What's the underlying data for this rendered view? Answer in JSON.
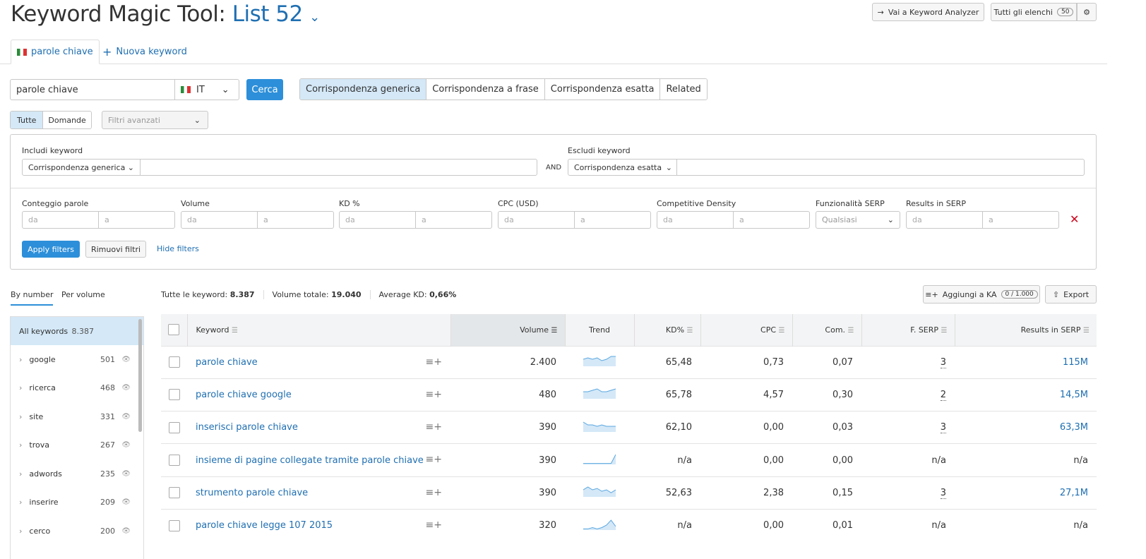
{
  "header": {
    "title": "Keyword Magic Tool:",
    "list_name": "List 52",
    "analyzer_btn": "Vai a Keyword Analyzer",
    "all_lists_btn": "Tutti gli elenchi",
    "all_lists_count": "50"
  },
  "tabs": [
    {
      "label": "parole chiave"
    },
    {
      "label": "Nuova keyword"
    }
  ],
  "search": {
    "value": "parole chiave",
    "country": "IT",
    "search_btn": "Cerca"
  },
  "match_modes": [
    "Corrispondenza generica",
    "Corrispondenza a frase",
    "Corrispondenza esatta",
    "Related"
  ],
  "question_filter": [
    "Tutte",
    "Domande"
  ],
  "advanced_filters": "Filtri avanzati",
  "filters": {
    "include_label": "Includi keyword",
    "include_mode": "Corrispondenza generica",
    "and": "AND",
    "exclude_label": "Escludi keyword",
    "exclude_mode": "Corrispondenza esatta",
    "ranges": [
      "Conteggio parole",
      "Volume",
      "KD %",
      "CPC (USD)",
      "Competitive Density"
    ],
    "from": "da",
    "to": "a",
    "serp_features_label": "Funzionalità SERP",
    "serp_features_value": "Qualsiasi",
    "results_label": "Results in SERP",
    "apply": "Apply filters",
    "remove": "Rimuovi filtri",
    "hide": "Hide filters"
  },
  "sidebar": {
    "tabs": [
      "By number",
      "Per volume"
    ],
    "all_label": "All keywords",
    "all_count": "8.387",
    "items": [
      {
        "label": "google",
        "count": "501"
      },
      {
        "label": "ricerca",
        "count": "468"
      },
      {
        "label": "site",
        "count": "331"
      },
      {
        "label": "trova",
        "count": "267"
      },
      {
        "label": "adwords",
        "count": "235"
      },
      {
        "label": "inserire",
        "count": "209"
      },
      {
        "label": "cerco",
        "count": "200"
      }
    ]
  },
  "summary": {
    "all_label": "Tutte le keyword:",
    "all_value": "8.387",
    "volume_label": "Volume totale:",
    "volume_value": "19.040",
    "kd_label": "Average KD:",
    "kd_value": "0,66%",
    "add_ka": "Aggiungi a KA",
    "ka_count": "0 / 1.000",
    "export": "Export"
  },
  "table": {
    "columns": [
      "Keyword",
      "Volume",
      "Trend",
      "KD%",
      "CPC",
      "Com.",
      "F. SERP",
      "Results in SERP"
    ],
    "rows": [
      {
        "keyword": "parole chiave",
        "volume": "2.400",
        "trend": [
          5,
          6,
          5,
          6,
          4,
          5,
          7,
          7
        ],
        "kd": "65,48",
        "cpc": "0,73",
        "com": "0,07",
        "fserp": "3",
        "results": "115M"
      },
      {
        "keyword": "parole chiave google",
        "volume": "480",
        "trend": [
          5,
          5,
          6,
          7,
          5,
          5,
          6,
          7
        ],
        "kd": "65,78",
        "cpc": "4,57",
        "com": "0,30",
        "fserp": "2",
        "results": "14,5M"
      },
      {
        "keyword": "inserisci parole chiave",
        "volume": "390",
        "trend": [
          7,
          5,
          5,
          4,
          5,
          4,
          4,
          4
        ],
        "kd": "62,10",
        "cpc": "0,00",
        "com": "0,03",
        "fserp": "3",
        "results": "63,3M"
      },
      {
        "keyword": "insieme di pagine collegate tramite parole chiave",
        "volume": "390",
        "trend": [
          1,
          1,
          1,
          1,
          1,
          1,
          1,
          10
        ],
        "kd": "n/a",
        "cpc": "0,00",
        "com": "0,00",
        "fserp": "n/a",
        "results": "n/a"
      },
      {
        "keyword": "strumento parole chiave",
        "volume": "390",
        "trend": [
          5,
          7,
          5,
          6,
          4,
          5,
          3,
          5
        ],
        "kd": "52,63",
        "cpc": "2,38",
        "com": "0,15",
        "fserp": "3",
        "results": "27,1M"
      },
      {
        "keyword": "parole chiave legge 107 2015",
        "volume": "320",
        "trend": [
          1,
          1,
          2,
          1,
          2,
          4,
          8,
          3
        ],
        "kd": "n/a",
        "cpc": "0,00",
        "com": "0,01",
        "fserp": "n/a",
        "results": "n/a"
      }
    ]
  },
  "colors": {
    "accent": "#2d8fd9",
    "link": "#1f6fb2",
    "selected": "#d4e8f7",
    "remove": "#d0021b"
  }
}
